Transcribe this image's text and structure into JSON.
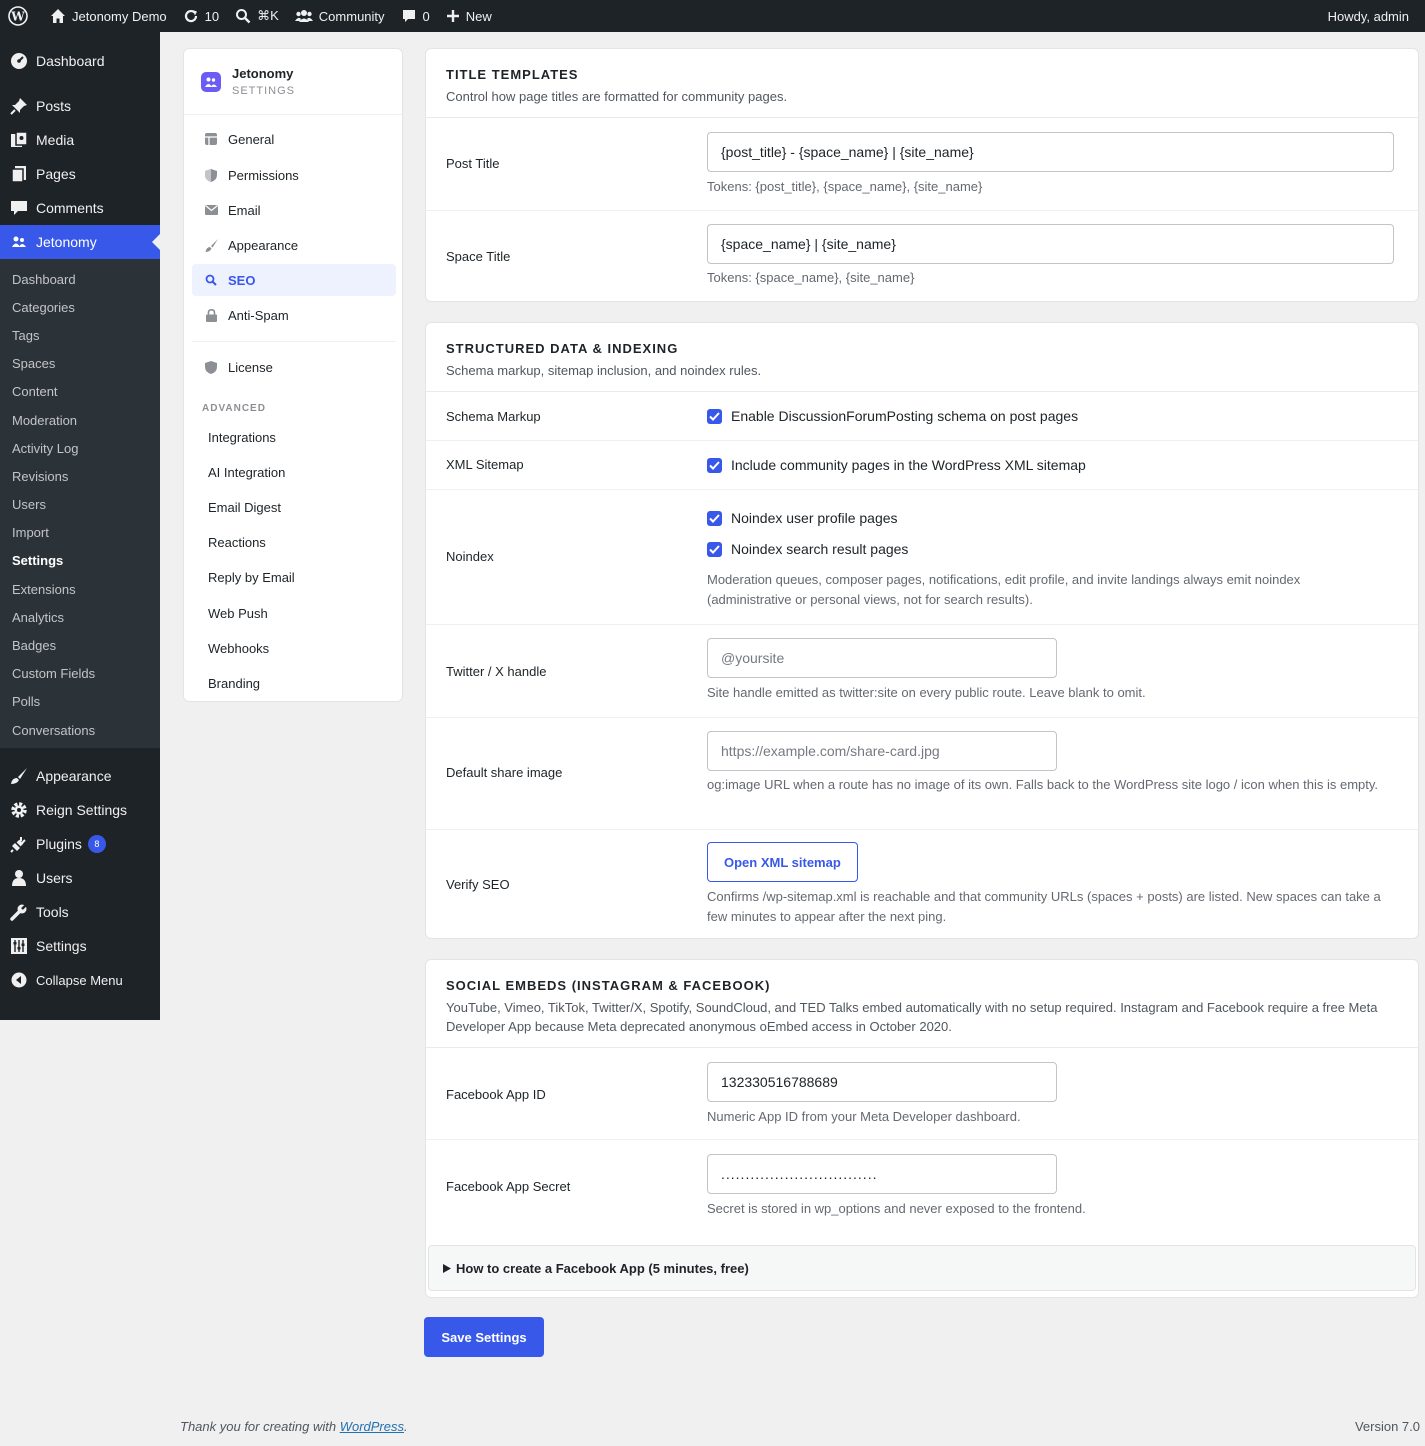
{
  "adminbar": {
    "site_name": "Jetonomy Demo",
    "updates_count": "10",
    "search_shortcut": "⌘K",
    "community": "Community",
    "comments_count": "0",
    "new_label": "New",
    "howdy": "Howdy, admin"
  },
  "menu": {
    "dashboard": "Dashboard",
    "posts": "Posts",
    "media": "Media",
    "pages": "Pages",
    "comments": "Comments",
    "jetonomy": "Jetonomy",
    "submenu": [
      "Dashboard",
      "Categories",
      "Tags",
      "Spaces",
      "Content",
      "Moderation",
      "Activity Log",
      "Revisions",
      "Users",
      "Import",
      "Settings",
      "Extensions",
      "Analytics",
      "Badges",
      "Custom Fields",
      "Polls",
      "Conversations"
    ],
    "appearance": "Appearance",
    "reign_settings": "Reign Settings",
    "plugins": "Plugins",
    "plugins_badge": "8",
    "users": "Users",
    "tools": "Tools",
    "settings": "Settings",
    "collapse": "Collapse Menu"
  },
  "settings_nav": {
    "brand": "Jetonomy",
    "brand_sub": "SETTINGS",
    "items": [
      "General",
      "Permissions",
      "Email",
      "Appearance",
      "SEO",
      "Anti-Spam",
      "License"
    ],
    "active": "SEO",
    "advanced_label": "ADVANCED",
    "advanced_items": [
      "Integrations",
      "AI Integration",
      "Email Digest",
      "Reactions",
      "Reply by Email",
      "Web Push",
      "Webhooks",
      "Branding"
    ]
  },
  "title_templates": {
    "title": "TITLE TEMPLATES",
    "desc": "Control how page titles are formatted for community pages.",
    "post_title_label": "Post Title",
    "post_title_value": "{post_title} - {space_name} | {site_name}",
    "post_title_help": "Tokens: {post_title}, {space_name}, {site_name}",
    "space_title_label": "Space Title",
    "space_title_value": "{space_name} | {site_name}",
    "space_title_help": "Tokens: {space_name}, {site_name}"
  },
  "structured": {
    "title": "STRUCTURED DATA & INDEXING",
    "desc": "Schema markup, sitemap inclusion, and noindex rules.",
    "schema_label": "Schema Markup",
    "schema_check": "Enable DiscussionForumPosting schema on post pages",
    "sitemap_label": "XML Sitemap",
    "sitemap_check": "Include community pages in the WordPress XML sitemap",
    "noindex_label": "Noindex",
    "noindex_check1": "Noindex user profile pages",
    "noindex_check2": "Noindex search result pages",
    "noindex_help": "Moderation queues, composer pages, notifications, edit profile, and invite landings always emit noindex (administrative or personal views, not for search results).",
    "twitter_label": "Twitter / X handle",
    "twitter_placeholder": "@yoursite",
    "twitter_help": "Site handle emitted as twitter:site on every public route. Leave blank to omit.",
    "share_label": "Default share image",
    "share_placeholder": "https://example.com/share-card.jpg",
    "share_help": "og:image URL when a route has no image of its own. Falls back to the WordPress site logo / icon when this is empty.",
    "verify_label": "Verify SEO",
    "verify_button": "Open XML sitemap",
    "verify_help": "Confirms /wp-sitemap.xml is reachable and that community URLs (spaces + posts) are listed. New spaces can take a few minutes to appear after the next ping."
  },
  "social": {
    "title": "SOCIAL EMBEDS (INSTAGRAM & FACEBOOK)",
    "desc": "YouTube, Vimeo, TikTok, Twitter/X, Spotify, SoundCloud, and TED Talks embed automatically with no setup required. Instagram and Facebook require a free Meta Developer App because Meta deprecated anonymous oEmbed access in October 2020.",
    "app_id_label": "Facebook App ID",
    "app_id_value": "132330516788689",
    "app_id_help": "Numeric App ID from your Meta Developer dashboard.",
    "app_secret_label": "Facebook App Secret",
    "app_secret_value": "................................",
    "app_secret_help": "Secret is stored in wp_options and never exposed to the frontend.",
    "howto": "How to create a Facebook App (5 minutes, free)"
  },
  "save_button": "Save Settings",
  "footer": {
    "thanks_prefix": "Thank you for creating with ",
    "thanks_link": "WordPress",
    "thanks_suffix": ".",
    "version": "Version 7.0"
  },
  "colors": {
    "accent": "#3858e9",
    "adminbar": "#1d2327",
    "background": "#f0f0f1"
  }
}
